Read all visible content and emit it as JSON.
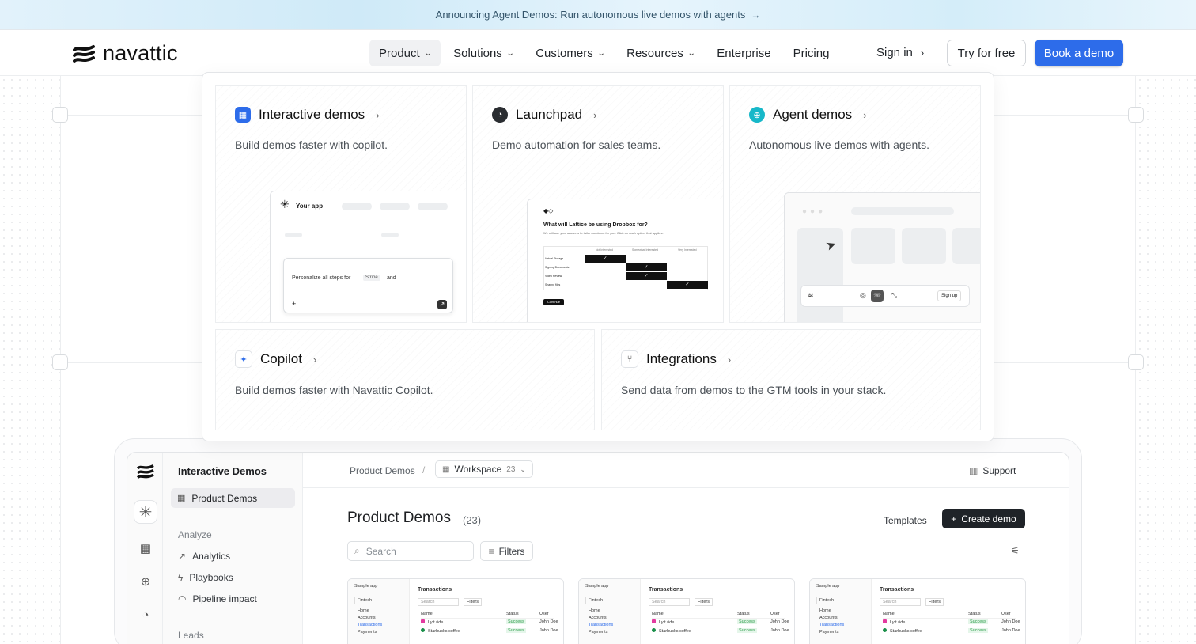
{
  "banner": {
    "text": "Announcing Agent Demos: Run autonomous live demos with agents",
    "arrow": "→"
  },
  "brand": {
    "name": "navattic",
    "accent": "#2d6cea"
  },
  "nav": {
    "items": [
      {
        "label": "Product",
        "chevron": true,
        "active": true
      },
      {
        "label": "Solutions",
        "chevron": true
      },
      {
        "label": "Customers",
        "chevron": true
      },
      {
        "label": "Resources",
        "chevron": true
      },
      {
        "label": "Enterprise"
      },
      {
        "label": "Pricing"
      }
    ],
    "sign_in": "Sign in",
    "try_free": "Try for free",
    "book_demo": "Book a demo"
  },
  "menu": {
    "interactive": {
      "title": "Interactive demos",
      "desc": "Build demos faster with copilot.",
      "mock": {
        "app": "Your app",
        "prompt": "Personalize all steps for",
        "chip": "Stripe",
        "suffix": "and"
      }
    },
    "launchpad": {
      "title": "Launchpad",
      "desc": "Demo automation for sales teams.",
      "mock": {
        "question": "What will Lattice be using Dropbox for?",
        "sub": "We will use your answers to tailor our demo for you. Click on each option that applies.",
        "cols": [
          "Not Interested",
          "Somewhat Interested",
          "Very Interested"
        ],
        "rows": [
          "Virtual Storage",
          "Signing Documents",
          "Video Review",
          "Sharing files"
        ],
        "button": "Continue"
      }
    },
    "agent": {
      "title": "Agent demos",
      "desc": "Autonomous live demos with agents.",
      "mock": {
        "signup": "Sign up"
      }
    },
    "copilot": {
      "title": "Copilot",
      "desc": "Build demos faster with Navattic Copilot."
    },
    "integrations": {
      "title": "Integrations",
      "desc": "Send data from demos to the GTM tools in your stack."
    }
  },
  "app": {
    "sidebar": {
      "title": "Interactive Demos",
      "active_item": "Product Demos",
      "sections": [
        {
          "label": "Analyze",
          "items": [
            "Analytics",
            "Playbooks",
            "Pipeline impact"
          ]
        },
        {
          "label": "Leads"
        }
      ]
    },
    "breadcrumb": {
      "root": "Product Demos",
      "workspace": "Workspace",
      "workspace_count": "23"
    },
    "support": "Support",
    "page_title": "Product Demos",
    "page_count": "(23)",
    "templates": "Templates",
    "create": "Create demo",
    "search_placeholder": "Search",
    "filters": "Filters",
    "thumb": {
      "app": "Sample app",
      "title": "Transactions",
      "nav": [
        "Home",
        "Accounts",
        "Transactions",
        "Payments"
      ],
      "select": "Fintech",
      "cols": [
        "Name",
        "Status",
        "User"
      ],
      "rows": [
        {
          "name": "Lyft ride",
          "status": "Success",
          "user": "John Doe"
        },
        {
          "name": "Starbucks coffee",
          "status": "Success",
          "user": "John Doe"
        }
      ]
    }
  }
}
